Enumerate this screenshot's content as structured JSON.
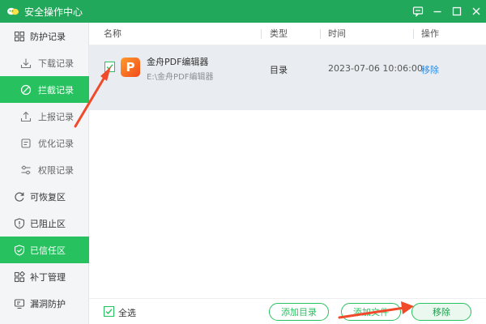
{
  "window": {
    "title": "安全操作中心"
  },
  "sidebar": {
    "items": [
      {
        "label": "防护记录",
        "icon": "shield-grid-icon",
        "level": "top",
        "active": false
      },
      {
        "label": "下载记录",
        "icon": "download-icon",
        "level": "sub",
        "active": false
      },
      {
        "label": "拦截记录",
        "icon": "block-icon",
        "level": "sub",
        "active": true
      },
      {
        "label": "上报记录",
        "icon": "upload-icon",
        "level": "sub",
        "active": false
      },
      {
        "label": "优化记录",
        "icon": "optimize-icon",
        "level": "sub",
        "active": false
      },
      {
        "label": "权限记录",
        "icon": "permission-icon",
        "level": "sub",
        "active": false
      },
      {
        "label": "可恢复区",
        "icon": "restore-icon",
        "level": "top",
        "active": false
      },
      {
        "label": "已阻止区",
        "icon": "blocked-shield-icon",
        "level": "top",
        "active": false
      },
      {
        "label": "已信任区",
        "icon": "trusted-shield-icon",
        "level": "top",
        "active": true
      },
      {
        "label": "补丁管理",
        "icon": "patch-icon",
        "level": "top",
        "active": false
      },
      {
        "label": "漏洞防护",
        "icon": "vulnerability-icon",
        "level": "top",
        "active": false
      }
    ]
  },
  "table": {
    "columns": [
      "名称",
      "类型",
      "时间",
      "操作"
    ],
    "rows": [
      {
        "checked": true,
        "name": "金舟PDF编辑器",
        "path": "E:\\金舟PDF编辑器",
        "type": "目录",
        "time": "2023-07-06 10:06:00",
        "action": "移除",
        "icon_letter": "P"
      }
    ]
  },
  "footer": {
    "select_all": "全选",
    "select_all_checked": true,
    "add_dir": "添加目录",
    "add_file": "添加文件",
    "remove": "移除"
  },
  "colors": {
    "titlebar": "#21a85a",
    "accent": "#27c25f",
    "link": "#2b8be6",
    "annotation_arrow": "#f04a2a"
  }
}
